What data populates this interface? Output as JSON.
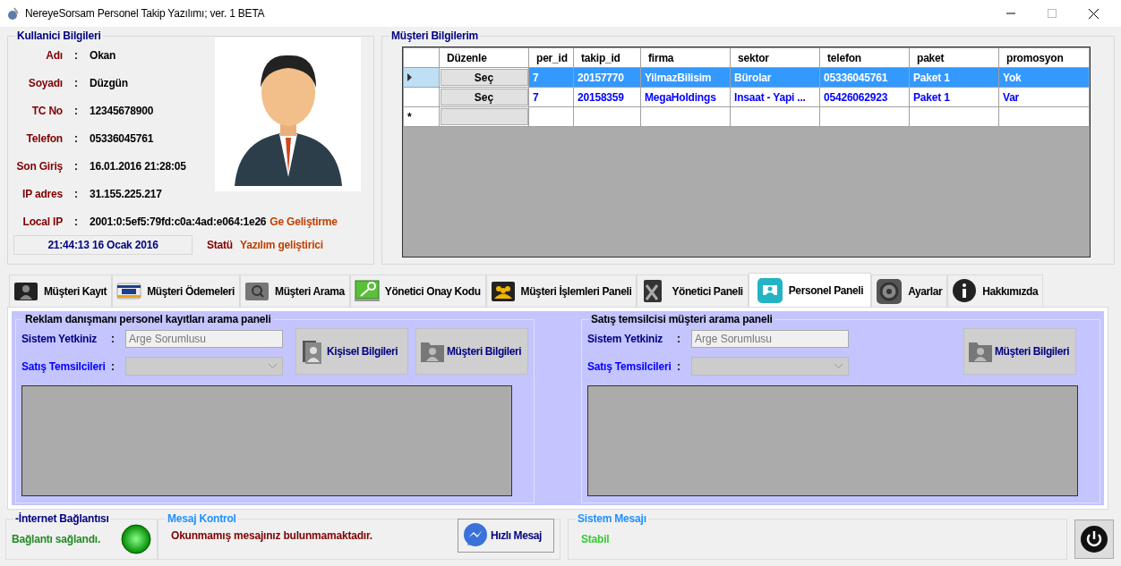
{
  "window": {
    "title": "NereyeSorsam Personel Takip Yazılımı; ver. 1 BETA"
  },
  "user_info": {
    "title": "Kullanici Bilgileri",
    "fields": [
      {
        "label": "Adı",
        "separator": ":",
        "value": "Okan"
      },
      {
        "label": "Soyadı",
        "separator": ":",
        "value": "Düzgün"
      },
      {
        "label": "TC No",
        "separator": ":",
        "value": "12345678900"
      },
      {
        "label": "Telefon",
        "separator": ":",
        "value": "05336045761"
      },
      {
        "label": "Son Giriş",
        "separator": ":",
        "value": "16.01.2016 21:28:05"
      },
      {
        "label": "IP adres",
        "separator": ":",
        "value": "31.155.225.217"
      },
      {
        "label": "Local IP",
        "separator": ":",
        "value": "2001:0:5ef5:79fd:c0a:4ad:e064:1e26"
      }
    ],
    "department": "Ge Geliştirme",
    "clock": "21:44:13 16 Ocak 2016",
    "status_label": "Statü",
    "status_value": "Yazılım geliştirici"
  },
  "customers": {
    "title": "Müşteri Bilgilerim",
    "columns": [
      "Düzenle",
      "per_id",
      "takip_id",
      "firma",
      "sektor",
      "telefon",
      "paket",
      "promosyon"
    ],
    "rows": [
      {
        "kind": "data",
        "selected": true,
        "button": "Seç",
        "cells": [
          "7",
          "20157770",
          "YilmazBilisim",
          "Bürolar",
          "05336045761",
          "Paket 1",
          "Yok"
        ]
      },
      {
        "kind": "data",
        "selected": false,
        "button": "Seç",
        "cells": [
          "7",
          "20158359",
          "MegaHoldings",
          "Insaat - Yapi ...",
          "05426062923",
          "Paket 1",
          "Var"
        ]
      },
      {
        "kind": "new",
        "marker": "*"
      }
    ]
  },
  "tabs": [
    {
      "label": "Müşteri Kayıt",
      "selected": false
    },
    {
      "label": "Müşteri Ödemeleri",
      "selected": false
    },
    {
      "label": "Müşteri Arama",
      "selected": false
    },
    {
      "label": "Yönetici Onay Kodu",
      "selected": false
    },
    {
      "label": "Müşteri İşlemleri Paneli",
      "selected": false
    },
    {
      "label": "Yönetici Paneli",
      "selected": false
    },
    {
      "label": "Personel Paneli",
      "selected": true
    },
    {
      "label": "Ayarlar",
      "selected": false
    },
    {
      "label": "Hakkımızda",
      "selected": false
    }
  ],
  "panels": [
    {
      "title": "Reklam danışmanı personel kayıtları arama paneli",
      "fields": [
        {
          "kind": "text",
          "label": "Sistem Yetkiniz",
          "separator": ":",
          "value": "Arge Sorumlusu",
          "disabled": true,
          "color": "#000080"
        },
        {
          "kind": "select",
          "label": "Satış Temsilcileri",
          "separator": ":",
          "disabled": true,
          "color": "#0000ff"
        }
      ],
      "buttons": [
        {
          "kind": "personal",
          "label": "Kişisel Bilgileri"
        },
        {
          "kind": "customers",
          "label": "Müşteri Bilgileri"
        }
      ]
    },
    {
      "title": "Satış temsilcisi müşteri arama paneli",
      "fields": [
        {
          "kind": "text",
          "label": "Sistem Yetkiniz",
          "separator": ":",
          "value": "Arge Sorumlusu",
          "disabled": true,
          "color": "#000080"
        },
        {
          "kind": "select",
          "label": "Satış Temsilcileri",
          "separator": ":",
          "disabled": true,
          "color": "#0000ff"
        }
      ],
      "buttons": [
        {
          "kind": "customers",
          "label": "Müşteri Bilgileri"
        }
      ]
    }
  ],
  "internet": {
    "title": "-İnternet Bağlantısı",
    "text": "Bağlantı sağlandı.",
    "connected": true
  },
  "messages": {
    "title": "Mesaj Kontrol",
    "text": "Okunmamış mesajınız bulunmamaktadır.",
    "button": "Hızlı Mesaj"
  },
  "system": {
    "title": "Sistem Mesajı",
    "text": "Stabil"
  }
}
